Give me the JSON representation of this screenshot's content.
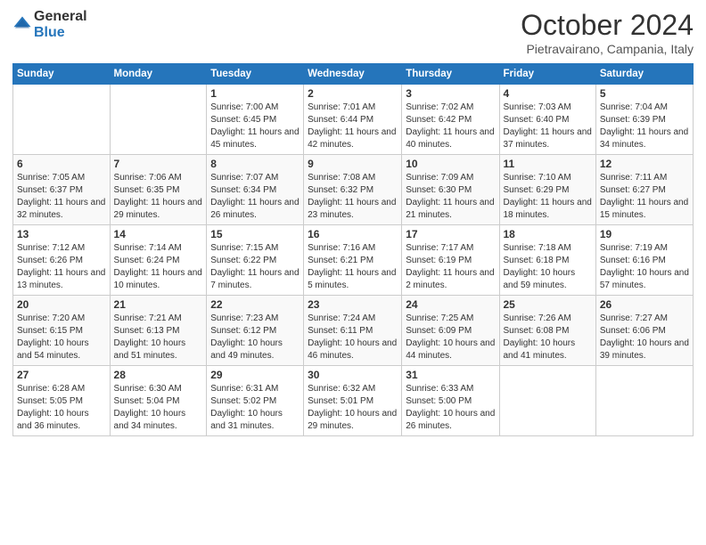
{
  "logo": {
    "text1": "General",
    "text2": "Blue"
  },
  "title": "October 2024",
  "location": "Pietravairano, Campania, Italy",
  "headers": [
    "Sunday",
    "Monday",
    "Tuesday",
    "Wednesday",
    "Thursday",
    "Friday",
    "Saturday"
  ],
  "weeks": [
    [
      {
        "day": "",
        "info": ""
      },
      {
        "day": "",
        "info": ""
      },
      {
        "day": "1",
        "sunrise": "Sunrise: 7:00 AM",
        "sunset": "Sunset: 6:45 PM",
        "daylight": "Daylight: 11 hours and 45 minutes."
      },
      {
        "day": "2",
        "sunrise": "Sunrise: 7:01 AM",
        "sunset": "Sunset: 6:44 PM",
        "daylight": "Daylight: 11 hours and 42 minutes."
      },
      {
        "day": "3",
        "sunrise": "Sunrise: 7:02 AM",
        "sunset": "Sunset: 6:42 PM",
        "daylight": "Daylight: 11 hours and 40 minutes."
      },
      {
        "day": "4",
        "sunrise": "Sunrise: 7:03 AM",
        "sunset": "Sunset: 6:40 PM",
        "daylight": "Daylight: 11 hours and 37 minutes."
      },
      {
        "day": "5",
        "sunrise": "Sunrise: 7:04 AM",
        "sunset": "Sunset: 6:39 PM",
        "daylight": "Daylight: 11 hours and 34 minutes."
      }
    ],
    [
      {
        "day": "6",
        "sunrise": "Sunrise: 7:05 AM",
        "sunset": "Sunset: 6:37 PM",
        "daylight": "Daylight: 11 hours and 32 minutes."
      },
      {
        "day": "7",
        "sunrise": "Sunrise: 7:06 AM",
        "sunset": "Sunset: 6:35 PM",
        "daylight": "Daylight: 11 hours and 29 minutes."
      },
      {
        "day": "8",
        "sunrise": "Sunrise: 7:07 AM",
        "sunset": "Sunset: 6:34 PM",
        "daylight": "Daylight: 11 hours and 26 minutes."
      },
      {
        "day": "9",
        "sunrise": "Sunrise: 7:08 AM",
        "sunset": "Sunset: 6:32 PM",
        "daylight": "Daylight: 11 hours and 23 minutes."
      },
      {
        "day": "10",
        "sunrise": "Sunrise: 7:09 AM",
        "sunset": "Sunset: 6:30 PM",
        "daylight": "Daylight: 11 hours and 21 minutes."
      },
      {
        "day": "11",
        "sunrise": "Sunrise: 7:10 AM",
        "sunset": "Sunset: 6:29 PM",
        "daylight": "Daylight: 11 hours and 18 minutes."
      },
      {
        "day": "12",
        "sunrise": "Sunrise: 7:11 AM",
        "sunset": "Sunset: 6:27 PM",
        "daylight": "Daylight: 11 hours and 15 minutes."
      }
    ],
    [
      {
        "day": "13",
        "sunrise": "Sunrise: 7:12 AM",
        "sunset": "Sunset: 6:26 PM",
        "daylight": "Daylight: 11 hours and 13 minutes."
      },
      {
        "day": "14",
        "sunrise": "Sunrise: 7:14 AM",
        "sunset": "Sunset: 6:24 PM",
        "daylight": "Daylight: 11 hours and 10 minutes."
      },
      {
        "day": "15",
        "sunrise": "Sunrise: 7:15 AM",
        "sunset": "Sunset: 6:22 PM",
        "daylight": "Daylight: 11 hours and 7 minutes."
      },
      {
        "day": "16",
        "sunrise": "Sunrise: 7:16 AM",
        "sunset": "Sunset: 6:21 PM",
        "daylight": "Daylight: 11 hours and 5 minutes."
      },
      {
        "day": "17",
        "sunrise": "Sunrise: 7:17 AM",
        "sunset": "Sunset: 6:19 PM",
        "daylight": "Daylight: 11 hours and 2 minutes."
      },
      {
        "day": "18",
        "sunrise": "Sunrise: 7:18 AM",
        "sunset": "Sunset: 6:18 PM",
        "daylight": "Daylight: 10 hours and 59 minutes."
      },
      {
        "day": "19",
        "sunrise": "Sunrise: 7:19 AM",
        "sunset": "Sunset: 6:16 PM",
        "daylight": "Daylight: 10 hours and 57 minutes."
      }
    ],
    [
      {
        "day": "20",
        "sunrise": "Sunrise: 7:20 AM",
        "sunset": "Sunset: 6:15 PM",
        "daylight": "Daylight: 10 hours and 54 minutes."
      },
      {
        "day": "21",
        "sunrise": "Sunrise: 7:21 AM",
        "sunset": "Sunset: 6:13 PM",
        "daylight": "Daylight: 10 hours and 51 minutes."
      },
      {
        "day": "22",
        "sunrise": "Sunrise: 7:23 AM",
        "sunset": "Sunset: 6:12 PM",
        "daylight": "Daylight: 10 hours and 49 minutes."
      },
      {
        "day": "23",
        "sunrise": "Sunrise: 7:24 AM",
        "sunset": "Sunset: 6:11 PM",
        "daylight": "Daylight: 10 hours and 46 minutes."
      },
      {
        "day": "24",
        "sunrise": "Sunrise: 7:25 AM",
        "sunset": "Sunset: 6:09 PM",
        "daylight": "Daylight: 10 hours and 44 minutes."
      },
      {
        "day": "25",
        "sunrise": "Sunrise: 7:26 AM",
        "sunset": "Sunset: 6:08 PM",
        "daylight": "Daylight: 10 hours and 41 minutes."
      },
      {
        "day": "26",
        "sunrise": "Sunrise: 7:27 AM",
        "sunset": "Sunset: 6:06 PM",
        "daylight": "Daylight: 10 hours and 39 minutes."
      }
    ],
    [
      {
        "day": "27",
        "sunrise": "Sunrise: 6:28 AM",
        "sunset": "Sunset: 5:05 PM",
        "daylight": "Daylight: 10 hours and 36 minutes."
      },
      {
        "day": "28",
        "sunrise": "Sunrise: 6:30 AM",
        "sunset": "Sunset: 5:04 PM",
        "daylight": "Daylight: 10 hours and 34 minutes."
      },
      {
        "day": "29",
        "sunrise": "Sunrise: 6:31 AM",
        "sunset": "Sunset: 5:02 PM",
        "daylight": "Daylight: 10 hours and 31 minutes."
      },
      {
        "day": "30",
        "sunrise": "Sunrise: 6:32 AM",
        "sunset": "Sunset: 5:01 PM",
        "daylight": "Daylight: 10 hours and 29 minutes."
      },
      {
        "day": "31",
        "sunrise": "Sunrise: 6:33 AM",
        "sunset": "Sunset: 5:00 PM",
        "daylight": "Daylight: 10 hours and 26 minutes."
      },
      {
        "day": "",
        "info": ""
      },
      {
        "day": "",
        "info": ""
      }
    ]
  ]
}
